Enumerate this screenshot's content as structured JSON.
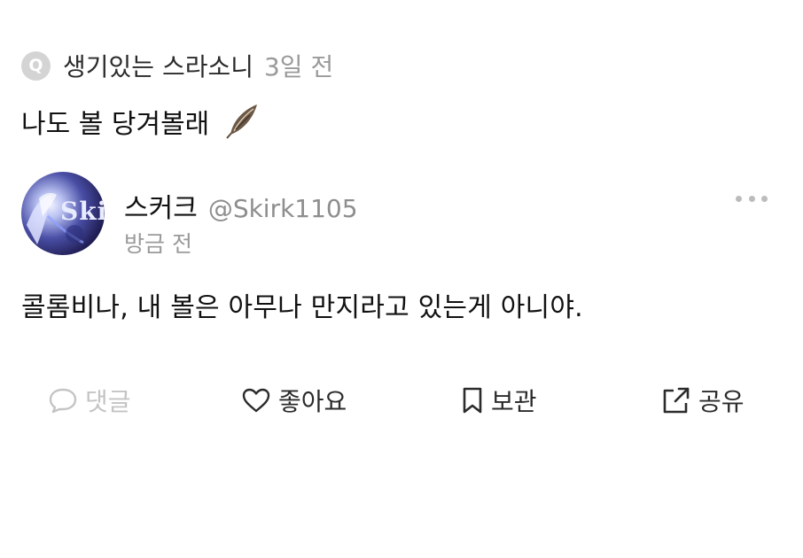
{
  "quote": {
    "badge": "Q",
    "author": "생기있는 스라소니",
    "time": "3일 전",
    "text": "나도 볼 당겨볼래",
    "trailing_icon": "feather-icon"
  },
  "post": {
    "avatar_text": "Ski",
    "display_name": "스커크",
    "handle": "@Skirk1105",
    "time": "방금 전",
    "text": "콜롬비나, 내 볼은 아무나 만지라고 있는게 아니야.",
    "more_icon": "more-dots-icon"
  },
  "actions": {
    "comment": {
      "label": "댓글",
      "icon": "speech-bubble-icon",
      "enabled": false
    },
    "like": {
      "label": "좋아요",
      "icon": "heart-icon"
    },
    "save": {
      "label": "보관",
      "icon": "bookmark-icon"
    },
    "share": {
      "label": "공유",
      "icon": "share-arrow-icon"
    }
  },
  "colors": {
    "text_primary": "#111111",
    "text_secondary": "#9a9a9a",
    "disabled": "#c4c4c4",
    "badge_bg": "#d4d4d4"
  }
}
